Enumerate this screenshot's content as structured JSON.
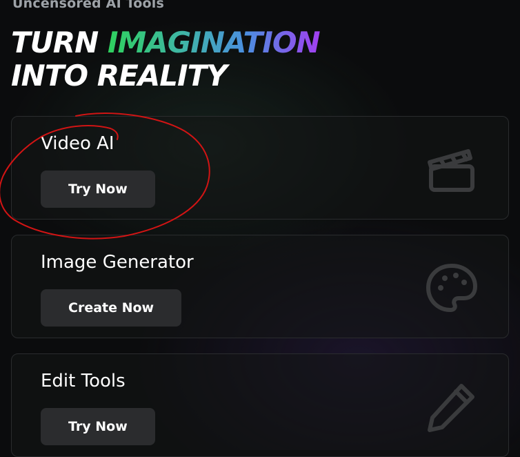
{
  "page": {
    "eyebrow": "Uncensored AI Tools",
    "headline": {
      "part1": "TURN ",
      "highlight": "IMAGINATION",
      "line2": "INTO REALITY"
    }
  },
  "cards": [
    {
      "title": "Video AI",
      "button": "Try Now",
      "icon": "clapperboard-icon"
    },
    {
      "title": "Image Generator",
      "button": "Create Now",
      "icon": "palette-icon"
    },
    {
      "title": "Edit Tools",
      "button": "Try Now",
      "icon": "pencil-icon"
    }
  ],
  "colors": {
    "background": "#0b0c0d",
    "card_border": "#2a2c2e",
    "button_bg": "#2b2c2e",
    "gradient_start": "#2fd15e",
    "gradient_end": "#a23ff0",
    "annotation_red": "#d21414"
  }
}
